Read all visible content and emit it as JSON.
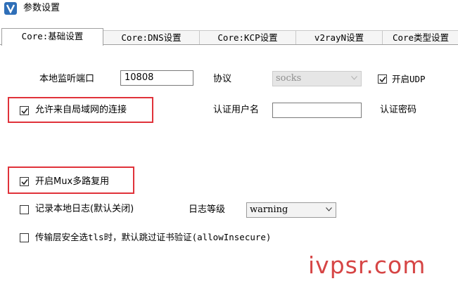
{
  "window": {
    "title": "参数设置"
  },
  "tabs": [
    {
      "label": "Core:基础设置"
    },
    {
      "label": "Core:DNS设置"
    },
    {
      "label": "Core:KCP设置"
    },
    {
      "label": "v2rayN设置"
    },
    {
      "label": "Core类型设置"
    }
  ],
  "form": {
    "local_port": {
      "label": "本地监听端口",
      "value": "10808"
    },
    "protocol": {
      "label": "协议",
      "value": "socks"
    },
    "enable_udp": {
      "label": "开启UDP",
      "checked": true
    },
    "allow_lan": {
      "label": "允许来自局域网的连接",
      "checked": true
    },
    "auth_user": {
      "label": "认证用户名",
      "value": ""
    },
    "auth_pass": {
      "label": "认证密码"
    },
    "enable_mux": {
      "label": "开启Mux多路复用",
      "checked": true
    },
    "log_local": {
      "label": "记录本地日志(默认关闭)",
      "checked": false
    },
    "log_level": {
      "label": "日志等级",
      "value": "warning"
    },
    "allow_insecure": {
      "label": "传输层安全选tls时，默认跳过证书验证(allowInsecure)",
      "checked": false
    }
  },
  "watermark": "ivpsr.com",
  "colors": {
    "highlight": "#e0323a",
    "watermark": "#d64545"
  }
}
